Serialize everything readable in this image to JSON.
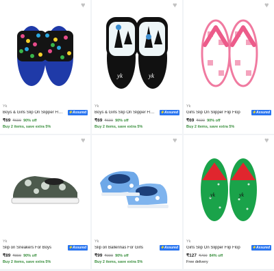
{
  "products": [
    {
      "brand": "Yk",
      "title": "Boys & Girls Slip On Slipper Flip Fl...",
      "assured": "Assured",
      "price": "₹69",
      "mrp": "₹699",
      "off": "90% off",
      "offer": "Buy 2 items, save extra 5%"
    },
    {
      "brand": "Yk",
      "title": "Boys & Girls Slip On Slipper Flip Fl...",
      "assured": "Assured",
      "price": "₹69",
      "mrp": "₹699",
      "off": "90% off",
      "offer": "Buy 2 items, save extra 5%"
    },
    {
      "brand": "Yk",
      "title": "Girls Slip On Slipper Flip Flop",
      "assured": "Assured",
      "price": "₹69",
      "mrp": "₹699",
      "off": "90% off",
      "offer": "Buy 2 items, save extra 5%"
    },
    {
      "brand": "Yk",
      "title": "Slip on Sneakers For Boys",
      "assured": "Assured",
      "price": "₹89",
      "mrp": "₹899",
      "off": "90% off",
      "offer": "Buy 2 items, save extra 5%"
    },
    {
      "brand": "Yk",
      "title": "Slip on Ballerinas For Girls",
      "assured": "Assured",
      "price": "₹99",
      "mrp": "₹999",
      "off": "90% off",
      "offer": "Buy 2 items, save extra 5%"
    },
    {
      "brand": "Yk",
      "title": "Girls Slip On Slipper Flip Flop",
      "assured": "Assured",
      "price": "₹127",
      "mrp": "₹799",
      "off": "84% off",
      "delivery": "Free delivery"
    }
  ],
  "icons": {
    "wishlist": "heart-icon",
    "assured": "assured-badge-icon"
  },
  "colors": {
    "price_green": "#388e3c",
    "assured_blue": "#2874f0",
    "wishlist_grey": "#c2c2c2"
  }
}
